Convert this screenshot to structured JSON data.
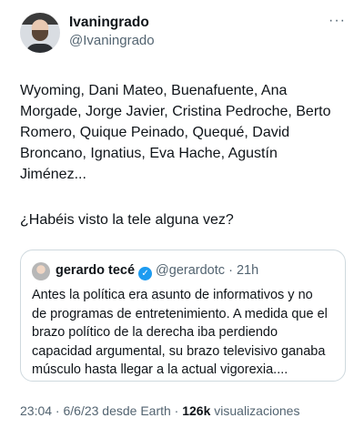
{
  "author": {
    "display_name": "Ivaningrado",
    "handle": "@Ivaningrado"
  },
  "tweet": {
    "text_lines": "Wyoming, Dani Mateo, Buenafuente, Ana\nMorgade, Jorge Javier, Cristina Pedroche, Berto\nRomero, Quique Peinado, Quequé, David\nBroncano, Ignatius, Eva Hache, Agustín\nJiménez...",
    "question": "¿Habéis visto la tele alguna vez?"
  },
  "quoted_tweet": {
    "name": "gerardo tecé",
    "handle": "@gerardotc",
    "separator": "·",
    "time": "21h",
    "text": "Antes la política era asunto de informativos y no\nde programas de entretenimiento. A medida que el\nbrazo político de la derecha iba perdiendo\ncapacidad argumental, su brazo televisivo ganaba\nmúsculo hasta llegar a la actual vigorexia...."
  },
  "meta": {
    "time_date": "23:04 · 6/6/23 desde Earth ·",
    "views_count": "126k",
    "views_label": "visualizaciones"
  },
  "icons": {
    "more": "more-icon",
    "verified": "verified-icon",
    "verified_color": "#1d9bf0"
  }
}
